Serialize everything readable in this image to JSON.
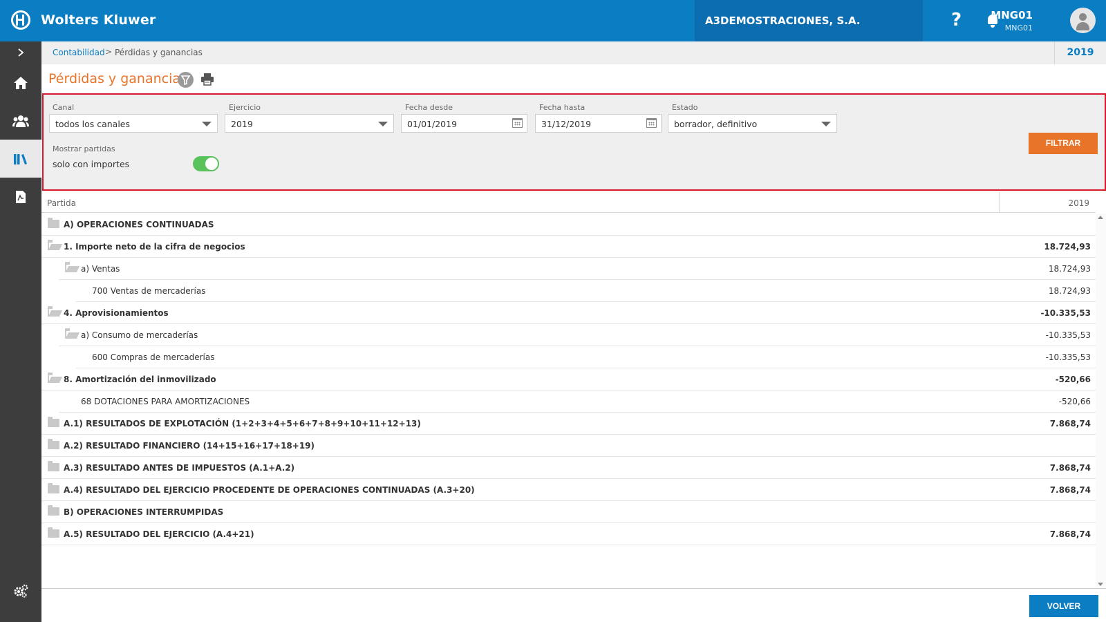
{
  "header": {
    "brand": "Wolters Kluwer",
    "company": "A3DEMOSTRACIONES, S.A.",
    "help_symbol": "?",
    "user_name": "MNG01",
    "user_sub": "MNG01"
  },
  "sidebar": {
    "items": [
      {
        "name": "expand",
        "icon": "chevron-right-icon"
      },
      {
        "name": "home",
        "icon": "home-icon"
      },
      {
        "name": "contacts",
        "icon": "users-icon"
      },
      {
        "name": "accounting",
        "icon": "books-icon",
        "active": true
      },
      {
        "name": "reports",
        "icon": "document-icon"
      },
      {
        "name": "settings",
        "icon": "gears-icon"
      }
    ]
  },
  "breadcrumb": {
    "link": "Contabilidad",
    "separator": ">",
    "current": "Pérdidas y ganancias",
    "year": "2019"
  },
  "page": {
    "title": "Pérdidas y ganancias"
  },
  "filters": {
    "canal_label": "Canal",
    "canal_value": "todos los canales",
    "ejercicio_label": "Ejercicio",
    "ejercicio_value": "2019",
    "desde_label": "Fecha desde",
    "desde_value": "01/01/2019",
    "hasta_label": "Fecha hasta",
    "hasta_value": "31/12/2019",
    "estado_label": "Estado",
    "estado_value": "borrador, definitivo",
    "mostrar_label": "Mostrar partidas",
    "mostrar_value": "solo con importes",
    "mostrar_on": true,
    "filtrar_label": "FILTRAR"
  },
  "table": {
    "col_partida": "Partida",
    "col_year": "2019",
    "rows": [
      {
        "label": "A) OPERACIONES CONTINUADAS",
        "amount": "",
        "bold": true,
        "level": 0,
        "icon": "folder-closed"
      },
      {
        "label": "1. Importe neto de la cifra de negocios",
        "amount": "18.724,93",
        "bold": true,
        "level": 0,
        "icon": "folder-open"
      },
      {
        "label": "a) Ventas",
        "amount": "18.724,93",
        "bold": false,
        "level": 1,
        "icon": "folder-open"
      },
      {
        "label": "700 Ventas de mercaderías",
        "amount": "18.724,93",
        "bold": false,
        "level": 2,
        "icon": ""
      },
      {
        "label": "4. Aprovisionamientos",
        "amount": "-10.335,53",
        "bold": true,
        "level": 0,
        "icon": "folder-open"
      },
      {
        "label": "a) Consumo de mercaderías",
        "amount": "-10.335,53",
        "bold": false,
        "level": 1,
        "icon": "folder-open"
      },
      {
        "label": "600 Compras de mercaderías",
        "amount": "-10.335,53",
        "bold": false,
        "level": 2,
        "icon": ""
      },
      {
        "label": "8. Amortización del inmovilizado",
        "amount": "-520,66",
        "bold": true,
        "level": 0,
        "icon": "folder-open"
      },
      {
        "label": "68 DOTACIONES PARA AMORTIZACIONES",
        "amount": "-520,66",
        "bold": false,
        "level": 1,
        "icon": ""
      },
      {
        "label": "A.1) RESULTADOS DE EXPLOTACIÓN (1+2+3+4+5+6+7+8+9+10+11+12+13)",
        "amount": "7.868,74",
        "bold": true,
        "level": 0,
        "icon": "folder-closed"
      },
      {
        "label": "A.2) RESULTADO FINANCIERO (14+15+16+17+18+19)",
        "amount": "",
        "bold": true,
        "level": 0,
        "icon": "folder-closed"
      },
      {
        "label": "A.3) RESULTADO ANTES DE IMPUESTOS (A.1+A.2)",
        "amount": "7.868,74",
        "bold": true,
        "level": 0,
        "icon": "folder-closed"
      },
      {
        "label": "A.4) RESULTADO DEL EJERCICIO PROCEDENTE DE OPERACIONES CONTINUADAS (A.3+20)",
        "amount": "7.868,74",
        "bold": true,
        "level": 0,
        "icon": "folder-closed"
      },
      {
        "label": "B) OPERACIONES INTERRUMPIDAS",
        "amount": "",
        "bold": true,
        "level": 0,
        "icon": "folder-closed"
      },
      {
        "label": "A.5) RESULTADO DEL EJERCICIO (A.4+21)",
        "amount": "7.868,74",
        "bold": true,
        "level": 0,
        "icon": "folder-closed"
      }
    ]
  },
  "footer": {
    "volver_label": "VOLVER"
  },
  "colors": {
    "primary_blue": "#0a7dc3",
    "accent_orange": "#e8742a",
    "highlight_red": "#d9182d",
    "toggle_green": "#59c25a",
    "sidebar_dark": "#3d3d3d"
  }
}
